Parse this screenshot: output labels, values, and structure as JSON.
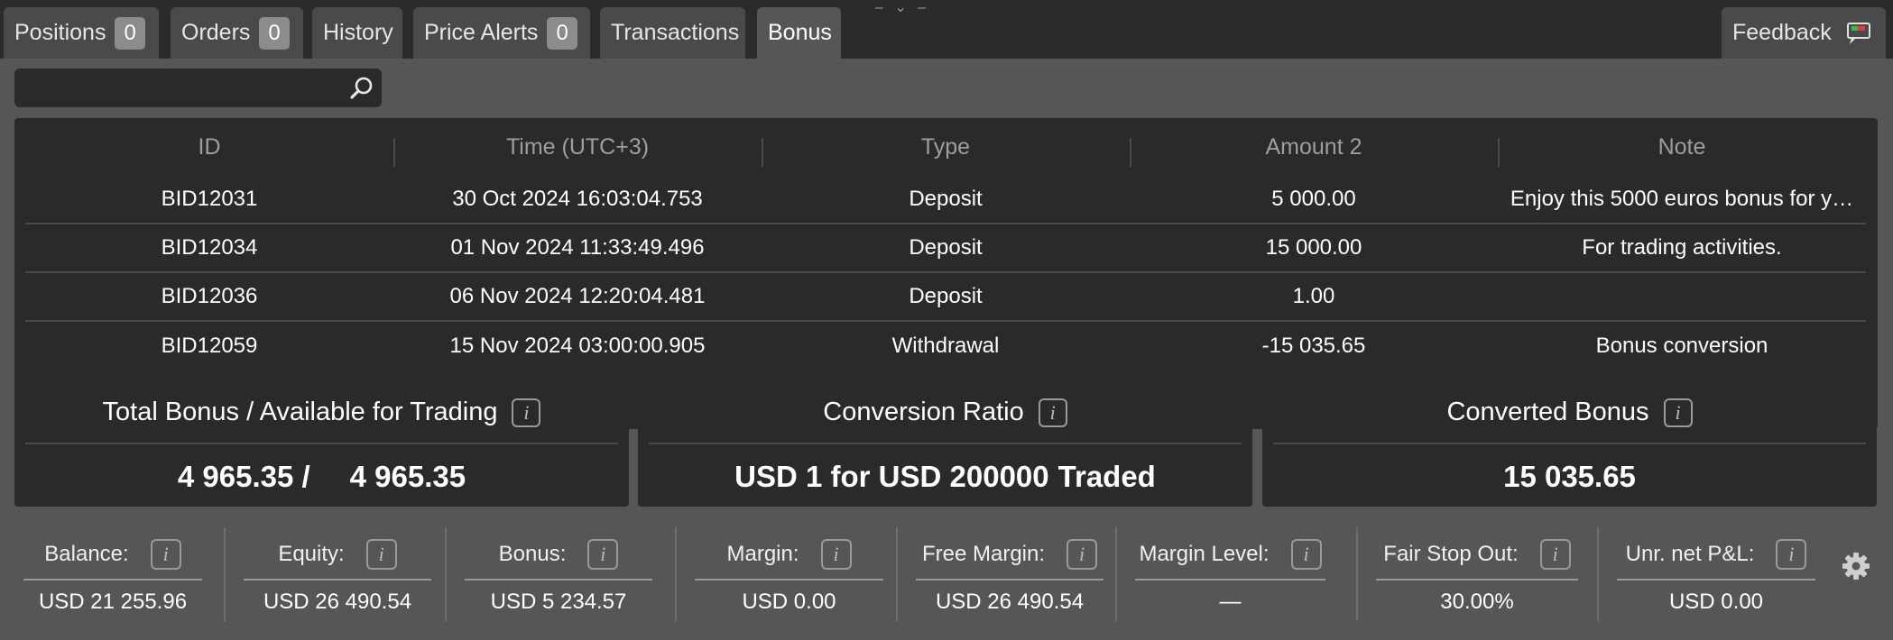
{
  "tabs": {
    "positions": {
      "label": "Positions",
      "count": "0"
    },
    "orders": {
      "label": "Orders",
      "count": "0"
    },
    "history": {
      "label": "History"
    },
    "price_alerts": {
      "label": "Price Alerts",
      "count": "0"
    },
    "transactions": {
      "label": "Transactions"
    },
    "bonus": {
      "label": "Bonus",
      "active": true
    },
    "feedback": {
      "label": "Feedback"
    }
  },
  "search": {
    "value": "",
    "placeholder": ""
  },
  "table": {
    "headers": [
      "ID",
      "Time (UTC+3)",
      "Type",
      "Amount 2",
      "Note"
    ],
    "rows": [
      [
        "BID12031",
        "30 Oct 2024 16:03:04.753",
        "Deposit",
        "5 000.00",
        "Enjoy this 5000 euros bonus for y…"
      ],
      [
        "BID12034",
        "01 Nov 2024 11:33:49.496",
        "Deposit",
        "15 000.00",
        "For trading activities."
      ],
      [
        "BID12036",
        "06 Nov 2024 12:20:04.481",
        "Deposit",
        "1.00",
        ""
      ],
      [
        "BID12059",
        "15 Nov 2024 03:00:00.905",
        "Withdrawal",
        "-15 035.65",
        "Bonus conversion"
      ]
    ]
  },
  "cards": [
    {
      "title": "Total Bonus / Available for Trading",
      "value_a": "4 965.35 /",
      "value_b": "4 965.35"
    },
    {
      "title": "Conversion Ratio",
      "value_a": "USD 1 for USD 200000",
      "value_b": "Traded"
    },
    {
      "title": "Converted Bonus",
      "value_a": "15 035.65",
      "value_b": ""
    }
  ],
  "stats": [
    {
      "label": "Balance:",
      "value": "USD 21 255.96"
    },
    {
      "label": "Equity:",
      "value": "USD 26 490.54"
    },
    {
      "label": "Bonus:",
      "value": "USD 5 234.57"
    },
    {
      "label": "Margin:",
      "value": "USD 0.00"
    },
    {
      "label": "Free Margin:",
      "value": "USD 26 490.54"
    },
    {
      "label": "Margin Level:",
      "value": "—"
    },
    {
      "label": "Fair Stop Out:",
      "value": "30.00%"
    },
    {
      "label": "Unr. net P&L:",
      "value": "USD 0.00"
    }
  ],
  "icons": {
    "search": "search-icon",
    "feedback": "feedback-flag-icon",
    "info": "info-icon",
    "settings": "gear-icon"
  },
  "colors": {
    "background": "#2b2b2b",
    "panel": "#565656",
    "surface": "#2a2a2a",
    "tab": "#4a4a4a",
    "badge": "#8c8c8c",
    "header_text": "#9e9e9e"
  }
}
